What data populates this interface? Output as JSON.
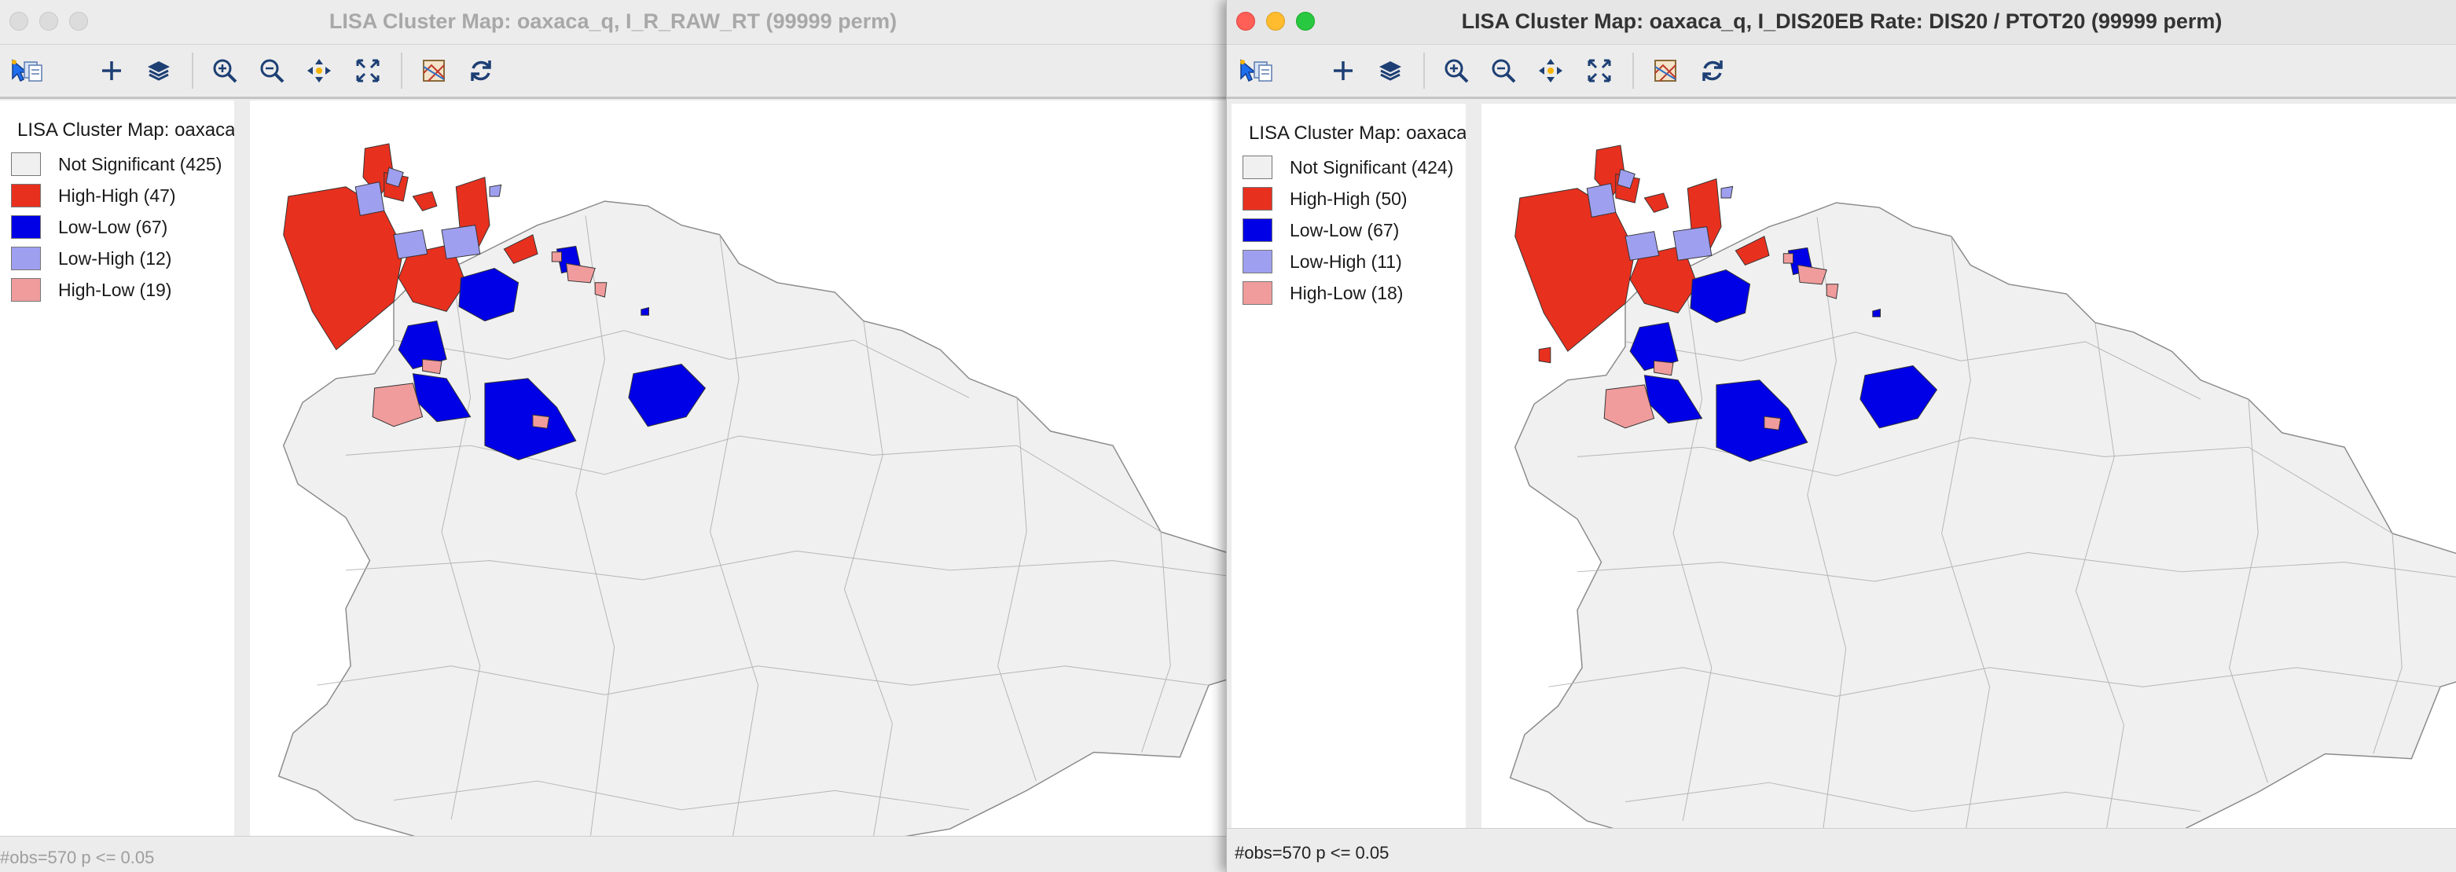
{
  "colors": {
    "not_significant": "#f0f0f0",
    "high_high": "#e8301f",
    "low_low": "#0000e6",
    "low_high": "#9f9ff0",
    "high_low": "#f09c9c",
    "boundary": "#8a8a8a"
  },
  "toolbar_icons": [
    "select-arrow-icon",
    "copy-icon",
    "add-icon",
    "layers-icon",
    "zoom-in-icon",
    "zoom-out-icon",
    "pan-icon",
    "full-extent-icon",
    "basemap-icon",
    "refresh-icon"
  ],
  "windows": [
    {
      "title": "LISA Cluster Map: oaxaca_q, I_R_RAW_RT (99999 perm)",
      "legend_title": "LISA Cluster Map: oaxaca",
      "legend": [
        {
          "label": "Not Significant (425)"
        },
        {
          "label": "High-High (47)"
        },
        {
          "label": "Low-Low (67)"
        },
        {
          "label": "Low-High (12)"
        },
        {
          "label": "High-Low (19)"
        }
      ],
      "status": "#obs=570  p <= 0.05"
    },
    {
      "title": "LISA Cluster Map: oaxaca_q, I_DIS20EB Rate: DIS20 / PTOT20 (99999 perm)",
      "legend_title": "LISA Cluster Map: oaxaca",
      "legend": [
        {
          "label": "Not Significant (424)"
        },
        {
          "label": "High-High (50)"
        },
        {
          "label": "Low-Low (67)"
        },
        {
          "label": "Low-High (11)"
        },
        {
          "label": "High-Low (18)"
        }
      ],
      "status": "#obs=570  p <= 0.05"
    }
  ]
}
